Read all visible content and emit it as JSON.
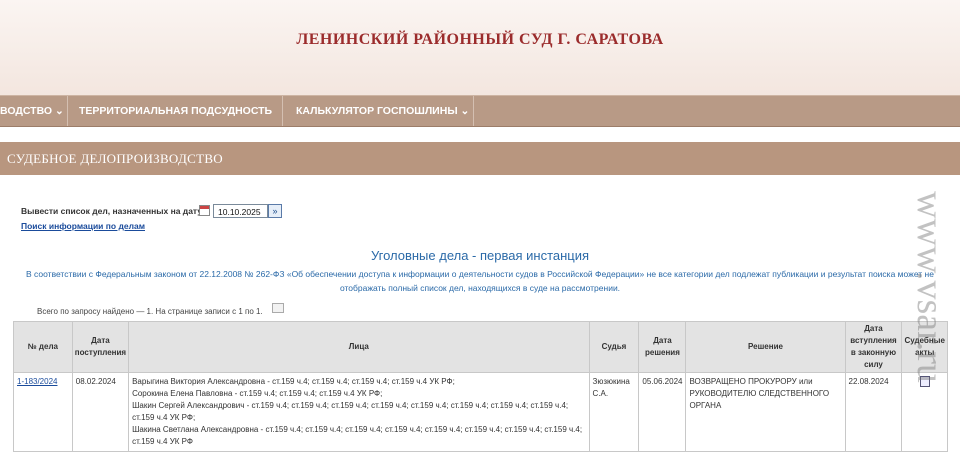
{
  "header": {
    "title": "ЛЕНИНСКИЙ РАЙОННЫЙ СУД Г. САРАТОВА"
  },
  "nav": {
    "items": [
      {
        "label": "ВОДСТВО ⌄"
      },
      {
        "label": "ТЕРРИТОРИАЛЬНАЯ ПОДСУДНОСТЬ ⌄"
      },
      {
        "label": "КАЛЬКУЛЯТОР ГОСПОШЛИНЫ ⌄"
      }
    ]
  },
  "section": {
    "title": "СУДЕБНОЕ ДЕЛОПРОИЗВОДСТВО"
  },
  "filter": {
    "date_label": "Вывести список дел, назначенных на дату",
    "date_value": "10.10.2025",
    "go_label": "»",
    "search_link": "Поиск информации по делам"
  },
  "category_title": "Уголовные дела - первая инстанция",
  "law_notice": "В соответствии с Федеральным законом от 22.12.2008 № 262-ФЗ «Об обеспечении доступа к информации о деятельности судов в Российской Федерации» не все категории дел подлежат публикации и результат поиска может не отображать полный список дел, находящихся в суде на рассмотрении.",
  "found_text": "Всего по запросу найдено — 1. На странице записи с 1 по 1.",
  "table": {
    "headers": [
      "№ дела",
      "Дата поступления",
      "Лица",
      "Судья",
      "Дата решения",
      "Решение",
      "Дата вступления в законную силу",
      "Судебные акты"
    ],
    "rows": [
      {
        "case_no": "1-183/2024",
        "received": "08.02.2024",
        "persons": [
          "Варыгина Виктория Александровна - ст.159 ч.4; ст.159 ч.4; ст.159 ч.4; ст.159 ч.4 УК РФ;",
          "Сорокина Елена Павловна - ст.159 ч.4; ст.159 ч.4; ст.159 ч.4 УК РФ;",
          "Шакин Сергей Александрович - ст.159 ч.4; ст.159 ч.4; ст.159 ч.4; ст.159 ч.4; ст.159 ч.4; ст.159 ч.4; ст.159 ч.4; ст.159 ч.4; ст.159 ч.4 УК РФ;",
          "Шакина Светлана Александровна - ст.159 ч.4; ст.159 ч.4; ст.159 ч.4; ст.159 ч.4; ст.159 ч.4; ст.159 ч.4; ст.159 ч.4; ст.159 ч.4; ст.159 ч.4 УК РФ"
        ],
        "judge": "Зюзюкина С.А.",
        "decision_date": "05.06.2024",
        "decision": "ВОЗВРАЩЕНО ПРОКУРОРУ или РУКОВОДИТЕЛЮ СЛЕДСТВЕННОГО ОРГАНА",
        "effective_date": "22.08.2024"
      }
    ]
  },
  "watermark": "www.vsar.ru"
}
